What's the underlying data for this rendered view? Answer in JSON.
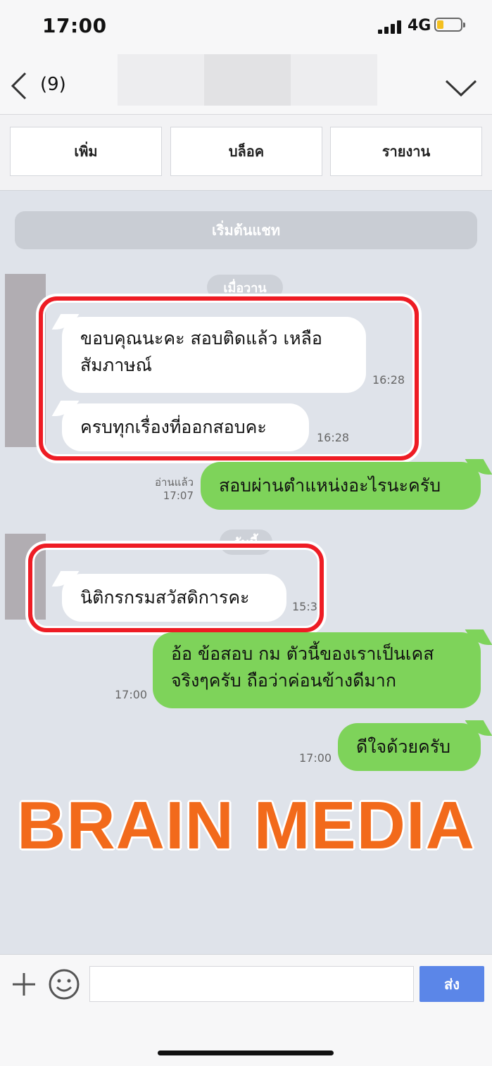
{
  "status_bar": {
    "time": "17:00",
    "network": "4G"
  },
  "header": {
    "member_count": "(9)"
  },
  "actions": {
    "add": "เพิ่ม",
    "block": "บล็อค",
    "report": "รายงาน"
  },
  "chat": {
    "start_label": "เริ่มต้นแชท",
    "date_yesterday": "เมื่อวาน",
    "date_today": "วันนี้",
    "messages": [
      {
        "from": "other",
        "text_line1": "ขอบคุณนะคะ สอบติดแล้ว เหลือ",
        "text_line2": "สัมภาษณ์",
        "time": "16:28"
      },
      {
        "from": "other",
        "text": "ครบทุกเรื่องที่ออกสอบคะ",
        "time": "16:28"
      },
      {
        "from": "me",
        "text": "สอบผ่านตำแหน่งอะไรนะครับ",
        "read_label": "อ่านแล้ว",
        "time": "17:07"
      },
      {
        "from": "other",
        "text": "นิติกรกรมสวัสดิการคะ",
        "time": "15:3"
      },
      {
        "from": "me",
        "text_line1": "อ้อ ข้อสอบ กม ตัวนี้ของเราเป็นเคส",
        "text_line2": "จริงๆครับ ถือว่าค่อนข้างดีมาก",
        "time": "17:00"
      },
      {
        "from": "me",
        "text": "ดีใจด้วยครับ",
        "time": "17:00"
      }
    ]
  },
  "watermark": "BRAIN MEDIA",
  "composer": {
    "send_label": "ส่ง",
    "input_value": ""
  },
  "colors": {
    "incoming": "#ffffff",
    "outgoing": "#7ed35a",
    "highlight": "#ee1c24",
    "watermark": "#f26a1b",
    "send": "#5b86e8"
  }
}
